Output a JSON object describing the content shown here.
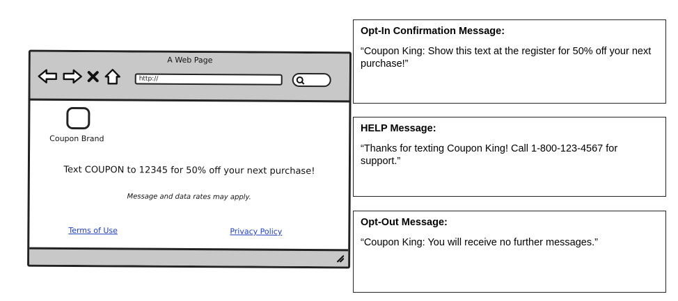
{
  "browser": {
    "title": "A Web Page",
    "url": "http://",
    "brand_label": "Coupon Brand",
    "headline": "Text COUPON to 12345 for 50% off your next purchase!",
    "disclaimer": "Message and data rates may apply.",
    "links": {
      "terms": "Terms of Use",
      "privacy": "Privacy Policy"
    },
    "icons": [
      "back-arrow-icon",
      "forward-arrow-icon",
      "close-icon",
      "home-icon",
      "search-icon",
      "resize-grip-icon"
    ]
  },
  "messages": [
    {
      "title": "Opt-In Confirmation Message:",
      "text": "“Coupon King: Show this text at the register for 50% off your next purchase!”"
    },
    {
      "title": "HELP Message:",
      "text": "“Thanks for texting Coupon King! Call 1-800-123-4567 for support.”"
    },
    {
      "title": "Opt-Out Message:",
      "text": "“Coupon King: You will receive no further messages.”"
    }
  ]
}
